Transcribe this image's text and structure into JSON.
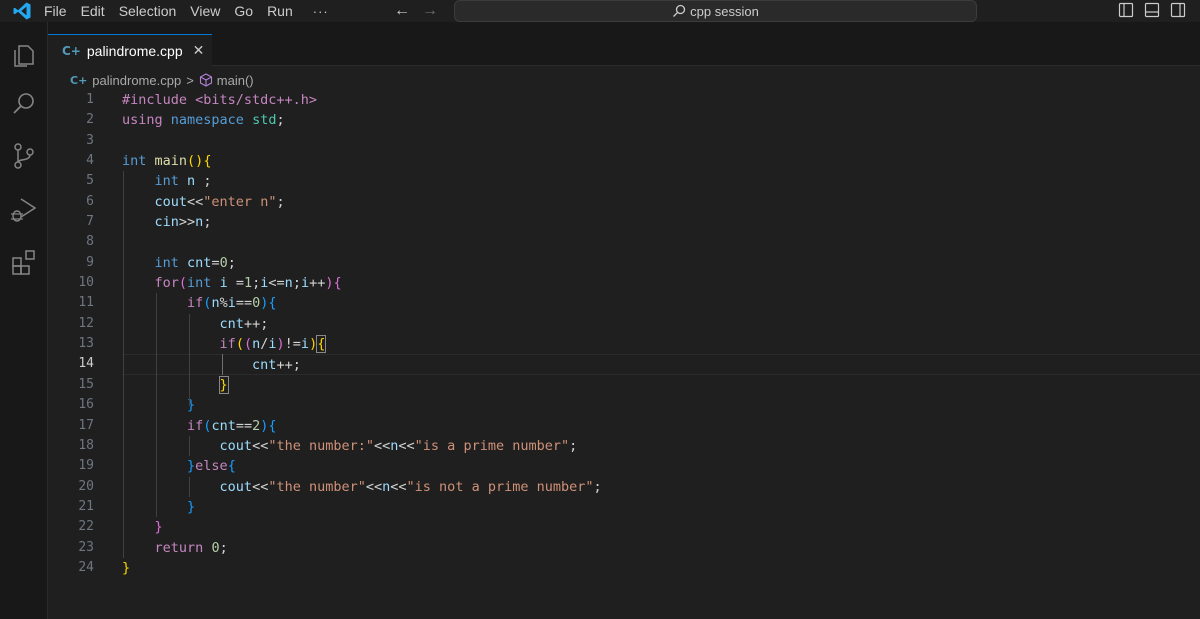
{
  "menu": {
    "items": [
      "File",
      "Edit",
      "Selection",
      "View",
      "Go",
      "Run"
    ],
    "more": "···"
  },
  "search": {
    "text": "cpp session"
  },
  "tab": {
    "label": "palindrome.cpp",
    "close": "✕",
    "icon": "C+"
  },
  "breadcrumb": {
    "file": "palindrome.cpp",
    "separator": ">",
    "symbol": "main()"
  },
  "editor": {
    "active_line": 14,
    "line_numbers": [
      "1",
      "2",
      "3",
      "4",
      "5",
      "6",
      "7",
      "8",
      "9",
      "10",
      "11",
      "12",
      "13",
      "14",
      "15",
      "16",
      "17",
      "18",
      "19",
      "20",
      "21",
      "22",
      "23",
      "24"
    ],
    "lines": [
      [
        {
          "t": "#include <bits/stdc++.h>",
          "c": "t-pp"
        }
      ],
      [
        {
          "t": "using",
          "c": "t-kw"
        },
        {
          "t": " ",
          "c": "t-op"
        },
        {
          "t": "namespace",
          "c": "t-type"
        },
        {
          "t": " ",
          "c": "t-op"
        },
        {
          "t": "std",
          "c": "t-ns"
        },
        {
          "t": ";",
          "c": "t-op"
        }
      ],
      [],
      [
        {
          "t": "int",
          "c": "t-type"
        },
        {
          "t": " ",
          "c": "t-op"
        },
        {
          "t": "main",
          "c": "t-fn"
        },
        {
          "t": "()",
          "c": "t-b1"
        },
        {
          "t": "{",
          "c": "t-b1"
        }
      ],
      [
        {
          "t": "    ",
          "c": "t-op"
        },
        {
          "t": "int",
          "c": "t-type"
        },
        {
          "t": " ",
          "c": "t-op"
        },
        {
          "t": "n",
          "c": "t-var"
        },
        {
          "t": " ;",
          "c": "t-op"
        }
      ],
      [
        {
          "t": "    ",
          "c": "t-op"
        },
        {
          "t": "cout",
          "c": "t-var"
        },
        {
          "t": "<<",
          "c": "t-op"
        },
        {
          "t": "\"enter n\"",
          "c": "t-str"
        },
        {
          "t": ";",
          "c": "t-op"
        }
      ],
      [
        {
          "t": "    ",
          "c": "t-op"
        },
        {
          "t": "cin",
          "c": "t-var"
        },
        {
          "t": ">>",
          "c": "t-op"
        },
        {
          "t": "n",
          "c": "t-var"
        },
        {
          "t": ";",
          "c": "t-op"
        }
      ],
      [],
      [
        {
          "t": "    ",
          "c": "t-op"
        },
        {
          "t": "int",
          "c": "t-type"
        },
        {
          "t": " ",
          "c": "t-op"
        },
        {
          "t": "cnt",
          "c": "t-var"
        },
        {
          "t": "=",
          "c": "t-op"
        },
        {
          "t": "0",
          "c": "t-num"
        },
        {
          "t": ";",
          "c": "t-op"
        }
      ],
      [
        {
          "t": "    ",
          "c": "t-op"
        },
        {
          "t": "for",
          "c": "t-kw"
        },
        {
          "t": "(",
          "c": "t-b2"
        },
        {
          "t": "int",
          "c": "t-type"
        },
        {
          "t": " ",
          "c": "t-op"
        },
        {
          "t": "i",
          "c": "t-var"
        },
        {
          "t": " =",
          "c": "t-op"
        },
        {
          "t": "1",
          "c": "t-num"
        },
        {
          "t": ";",
          "c": "t-op"
        },
        {
          "t": "i",
          "c": "t-var"
        },
        {
          "t": "<=",
          "c": "t-op"
        },
        {
          "t": "n",
          "c": "t-var"
        },
        {
          "t": ";",
          "c": "t-op"
        },
        {
          "t": "i",
          "c": "t-var"
        },
        {
          "t": "++",
          "c": "t-op"
        },
        {
          "t": ")",
          "c": "t-b2"
        },
        {
          "t": "{",
          "c": "t-b2"
        }
      ],
      [
        {
          "t": "        ",
          "c": "t-op"
        },
        {
          "t": "if",
          "c": "t-kw"
        },
        {
          "t": "(",
          "c": "t-b3"
        },
        {
          "t": "n",
          "c": "t-var"
        },
        {
          "t": "%",
          "c": "t-op"
        },
        {
          "t": "i",
          "c": "t-var"
        },
        {
          "t": "==",
          "c": "t-op"
        },
        {
          "t": "0",
          "c": "t-num"
        },
        {
          "t": ")",
          "c": "t-b3"
        },
        {
          "t": "{",
          "c": "t-b3"
        }
      ],
      [
        {
          "t": "            ",
          "c": "t-op"
        },
        {
          "t": "cnt",
          "c": "t-var"
        },
        {
          "t": "++;",
          "c": "t-op"
        }
      ],
      [
        {
          "t": "            ",
          "c": "t-op"
        },
        {
          "t": "if",
          "c": "t-kw"
        },
        {
          "t": "(",
          "c": "t-b1"
        },
        {
          "t": "(",
          "c": "t-b2"
        },
        {
          "t": "n",
          "c": "t-var"
        },
        {
          "t": "/",
          "c": "t-op"
        },
        {
          "t": "i",
          "c": "t-var"
        },
        {
          "t": ")",
          "c": "t-b2"
        },
        {
          "t": "!=",
          "c": "t-op"
        },
        {
          "t": "i",
          "c": "t-var"
        },
        {
          "t": ")",
          "c": "t-b1"
        },
        {
          "t": "{",
          "c": "t-b1",
          "box": true
        }
      ],
      [
        {
          "t": "                ",
          "c": "t-op"
        },
        {
          "t": "cnt",
          "c": "t-var"
        },
        {
          "t": "++;",
          "c": "t-op"
        }
      ],
      [
        {
          "t": "            ",
          "c": "t-op"
        },
        {
          "t": "}",
          "c": "t-b1",
          "box": true
        }
      ],
      [
        {
          "t": "        ",
          "c": "t-op"
        },
        {
          "t": "}",
          "c": "t-b3"
        }
      ],
      [
        {
          "t": "        ",
          "c": "t-op"
        },
        {
          "t": "if",
          "c": "t-kw"
        },
        {
          "t": "(",
          "c": "t-b3"
        },
        {
          "t": "cnt",
          "c": "t-var"
        },
        {
          "t": "==",
          "c": "t-op"
        },
        {
          "t": "2",
          "c": "t-num"
        },
        {
          "t": ")",
          "c": "t-b3"
        },
        {
          "t": "{",
          "c": "t-b3"
        }
      ],
      [
        {
          "t": "            ",
          "c": "t-op"
        },
        {
          "t": "cout",
          "c": "t-var"
        },
        {
          "t": "<<",
          "c": "t-op"
        },
        {
          "t": "\"the number:\"",
          "c": "t-str"
        },
        {
          "t": "<<",
          "c": "t-op"
        },
        {
          "t": "n",
          "c": "t-var"
        },
        {
          "t": "<<",
          "c": "t-op"
        },
        {
          "t": "\"is a prime number\"",
          "c": "t-str"
        },
        {
          "t": ";",
          "c": "t-op"
        }
      ],
      [
        {
          "t": "        ",
          "c": "t-op"
        },
        {
          "t": "}",
          "c": "t-b3"
        },
        {
          "t": "else",
          "c": "t-kw"
        },
        {
          "t": "{",
          "c": "t-b3"
        }
      ],
      [
        {
          "t": "            ",
          "c": "t-op"
        },
        {
          "t": "cout",
          "c": "t-var"
        },
        {
          "t": "<<",
          "c": "t-op"
        },
        {
          "t": "\"the number\"",
          "c": "t-str"
        },
        {
          "t": "<<",
          "c": "t-op"
        },
        {
          "t": "n",
          "c": "t-var"
        },
        {
          "t": "<<",
          "c": "t-op"
        },
        {
          "t": "\"is not a prime number\"",
          "c": "t-str"
        },
        {
          "t": ";",
          "c": "t-op"
        }
      ],
      [
        {
          "t": "        ",
          "c": "t-op"
        },
        {
          "t": "}",
          "c": "t-b3"
        }
      ],
      [
        {
          "t": "    ",
          "c": "t-op"
        },
        {
          "t": "}",
          "c": "t-b2"
        }
      ],
      [
        {
          "t": "    ",
          "c": "t-op"
        },
        {
          "t": "return",
          "c": "t-kw"
        },
        {
          "t": " ",
          "c": "t-op"
        },
        {
          "t": "0",
          "c": "t-num"
        },
        {
          "t": ";",
          "c": "t-op"
        }
      ],
      [
        {
          "t": "}",
          "c": "t-b1"
        }
      ]
    ]
  }
}
